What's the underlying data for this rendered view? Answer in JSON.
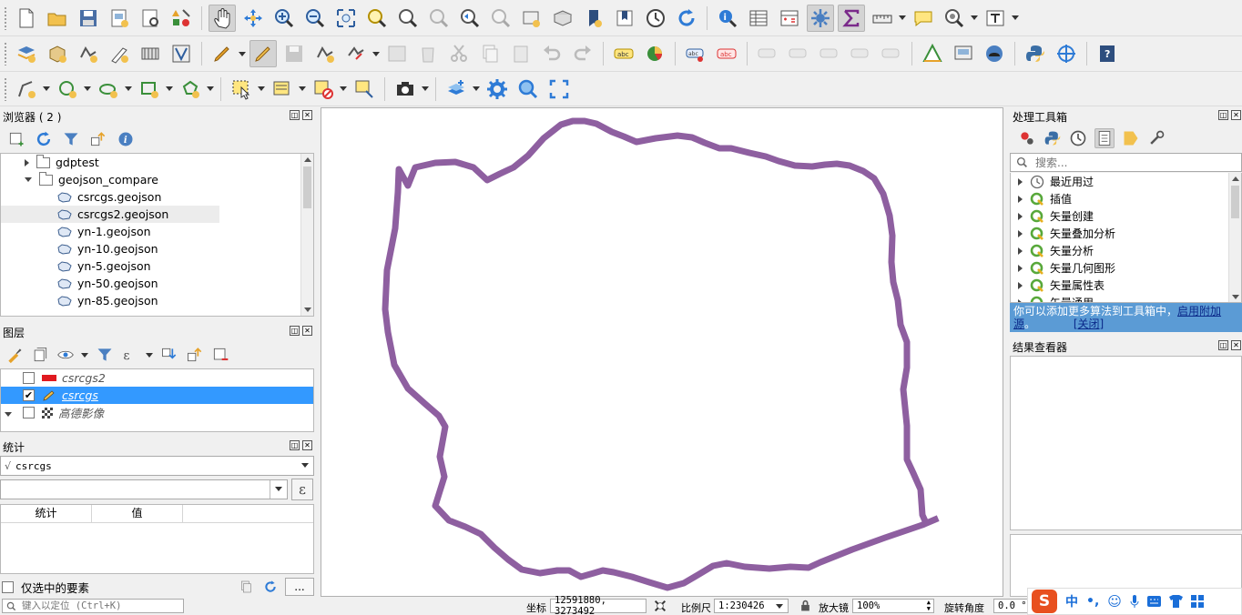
{
  "panels": {
    "browser": {
      "title": "浏览器 ( 2 )",
      "items": [
        {
          "label": "gdptest",
          "type": "folder",
          "expanded": false,
          "indent": 0
        },
        {
          "label": "geojson_compare",
          "type": "folder",
          "expanded": true,
          "indent": 0
        },
        {
          "label": "csrcgs.geojson",
          "type": "poly",
          "indent": 1
        },
        {
          "label": "csrcgs2.geojson",
          "type": "poly",
          "indent": 1,
          "selected": true
        },
        {
          "label": "yn-1.geojson",
          "type": "poly",
          "indent": 1
        },
        {
          "label": "yn-10.geojson",
          "type": "poly",
          "indent": 1
        },
        {
          "label": "yn-5.geojson",
          "type": "poly",
          "indent": 1
        },
        {
          "label": "yn-50.geojson",
          "type": "poly",
          "indent": 1
        },
        {
          "label": "yn-85.geojson",
          "type": "poly",
          "indent": 1
        }
      ]
    },
    "layers": {
      "title": "图层",
      "items": [
        {
          "label": "csrcgs2",
          "checked": false,
          "selected": false,
          "symbol": "red-rect",
          "expander": false
        },
        {
          "label": "csrcgs",
          "checked": true,
          "selected": true,
          "symbol": "pencil",
          "expander": false
        },
        {
          "label": "高德影像",
          "checked": false,
          "selected": false,
          "symbol": "checker",
          "expander": true
        }
      ]
    },
    "stats": {
      "title": "统计",
      "layer_combo": "csrcgs",
      "field_combo": "",
      "columns": [
        "统计",
        "值"
      ],
      "selected_only_label": "仅选中的要素",
      "more_button": "..."
    },
    "processing": {
      "title": "处理工具箱",
      "search_placeholder": "搜索...",
      "items": [
        "最近用过",
        "插值",
        "矢量创建",
        "矢量叠加分析",
        "矢量分析",
        "矢量几何图形",
        "矢量属性表",
        "矢量通用"
      ],
      "banner_text": "你可以添加更多算法到工具箱中，",
      "banner_link1": "启用附加",
      "banner_link2": "源",
      "banner_sep": "。",
      "banner_close": "[关闭]"
    },
    "results": {
      "title": "结果查看器"
    }
  },
  "status": {
    "locator_placeholder": "键入以定位 (Ctrl+K)",
    "coord_label": "坐标",
    "coord_value": "12591880, 3273492",
    "scale_label": "比例尺",
    "scale_value": "1:230426",
    "magnifier_label": "放大镜",
    "magnifier_value": "100%",
    "rotation_label": "旋转角度",
    "rotation_value": "0.0 °"
  },
  "ime": {
    "lang": "中"
  },
  "colors": {
    "line_feature": "#8e5fa0",
    "selection": "#3399ff",
    "banner": "#5b9bd5"
  }
}
